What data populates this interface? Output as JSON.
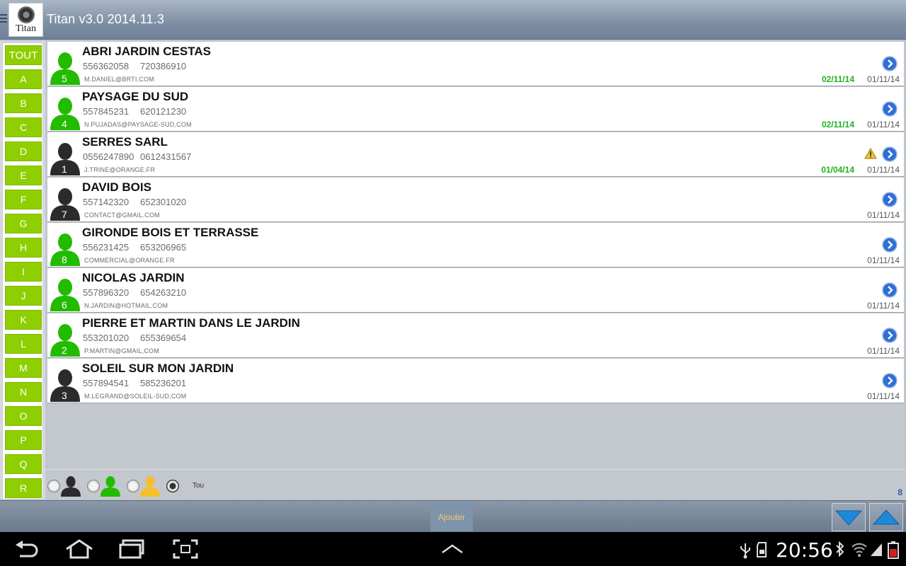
{
  "app": {
    "logo_text": "Titan",
    "title": "Titan v3.0  2014.11.3"
  },
  "sidebar": {
    "letters": [
      "TOUT",
      "A",
      "B",
      "C",
      "D",
      "E",
      "F",
      "G",
      "H",
      "I",
      "J",
      "K",
      "L",
      "M",
      "N",
      "O",
      "P",
      "Q",
      "R"
    ]
  },
  "contacts": [
    {
      "count": "5",
      "avatar_color": "#22bb00",
      "name": "ABRI JARDIN CESTAS",
      "phone1": "556362058",
      "phone2": "720386910",
      "email": "M.DANIEL@BRTI,COM",
      "date_green": "02/11/14",
      "date": "01/11/14",
      "warning": false
    },
    {
      "count": "4",
      "avatar_color": "#22bb00",
      "name": "PAYSAGE DU SUD",
      "phone1": "557845231",
      "phone2": "620121230",
      "email": "N.PUJADAS@PAYSAGE-SUD,COM",
      "date_green": "02/11/14",
      "date": "01/11/14",
      "warning": false
    },
    {
      "count": "1",
      "avatar_color": "#2b2b2b",
      "name": "SERRES SARL",
      "phone1": "0556247890",
      "phone2": "0612431567",
      "email": "J.TRINE@ORANGE.FR",
      "date_green": "01/04/14",
      "date": "01/11/14",
      "warning": true
    },
    {
      "count": "7",
      "avatar_color": "#2b2b2b",
      "name": "DAVID BOIS",
      "phone1": "557142320",
      "phone2": "652301020",
      "email": "CONTACT@GMAIL.COM",
      "date_green": "",
      "date": "01/11/14",
      "warning": false
    },
    {
      "count": "8",
      "avatar_color": "#22bb00",
      "name": "GIRONDE BOIS ET TERRASSE",
      "phone1": "556231425",
      "phone2": "653206965",
      "email": "COMMERCIAL@ORANGE.FR",
      "date_green": "",
      "date": "01/11/14",
      "warning": false
    },
    {
      "count": "6",
      "avatar_color": "#22bb00",
      "name": "NICOLAS JARDIN",
      "phone1": "557896320",
      "phone2": "654263210",
      "email": "N.JARDIN@HOTMAIL,COM",
      "date_green": "",
      "date": "01/11/14",
      "warning": false
    },
    {
      "count": "2",
      "avatar_color": "#22bb00",
      "name": "PIERRE ET MARTIN DANS LE JARDIN",
      "phone1": "553201020",
      "phone2": "655369654",
      "email": "P.MARTIN@GMAIL,COM",
      "date_green": "",
      "date": "01/11/14",
      "warning": false
    },
    {
      "count": "3",
      "avatar_color": "#2b2b2b",
      "name": "SOLEIL SUR MON JARDIN",
      "phone1": "557894541",
      "phone2": "585236201",
      "email": "M.LEGRAND@SOLEIL-SUD,COM",
      "date_green": "",
      "date": "01/11/14",
      "warning": false
    }
  ],
  "filters": {
    "options": [
      {
        "icon": "person-black-icon",
        "color": "#2b2b2b",
        "selected": false
      },
      {
        "icon": "person-green-icon",
        "color": "#22bb00",
        "selected": false
      },
      {
        "icon": "person-yellow-icon",
        "color": "#f5c02a",
        "selected": false
      },
      {
        "icon": "",
        "color": "",
        "selected": true
      }
    ],
    "all_label": "Tou",
    "total_count": "8"
  },
  "actions": {
    "add_label": "Ajouter"
  },
  "system": {
    "clock": "20:56"
  },
  "colors": {
    "accent_green": "#8fce00",
    "chevron_blue": "#2f6fd6"
  }
}
